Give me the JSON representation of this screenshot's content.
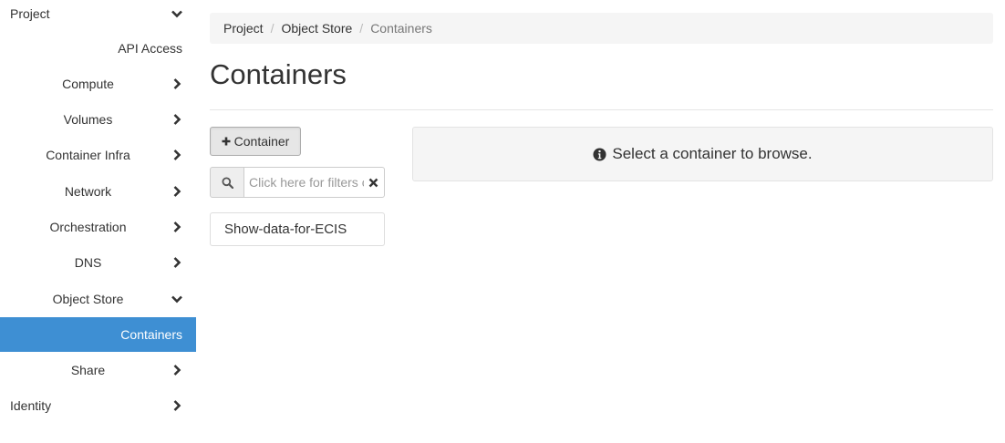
{
  "sidebar": {
    "project": "Project",
    "api_access": "API Access",
    "compute": "Compute",
    "volumes": "Volumes",
    "container_infra": "Container Infra",
    "network": "Network",
    "orchestration": "Orchestration",
    "dns": "DNS",
    "object_store": "Object Store",
    "containers": "Containers",
    "share": "Share",
    "identity": "Identity"
  },
  "breadcrumb": {
    "project": "Project",
    "object_store": "Object Store",
    "current": "Containers",
    "separator": "/"
  },
  "page": {
    "title": "Containers"
  },
  "actions": {
    "add_container": "Container"
  },
  "search": {
    "placeholder": "Click here for filters or full text search."
  },
  "containers": [
    "Show-data-for-ECIS"
  ],
  "info": {
    "message": "Select a container to browse."
  },
  "colors": {
    "active_nav_bg": "#3e8fd3",
    "active_nav_text": "#ffffff",
    "breadcrumb_bg": "#f5f5f5"
  },
  "icons": {
    "expanded": "chevron-down-icon",
    "collapsed": "chevron-right-icon",
    "add": "plus-icon",
    "search": "search-icon",
    "clear": "close-icon",
    "info": "info-circle-icon"
  }
}
